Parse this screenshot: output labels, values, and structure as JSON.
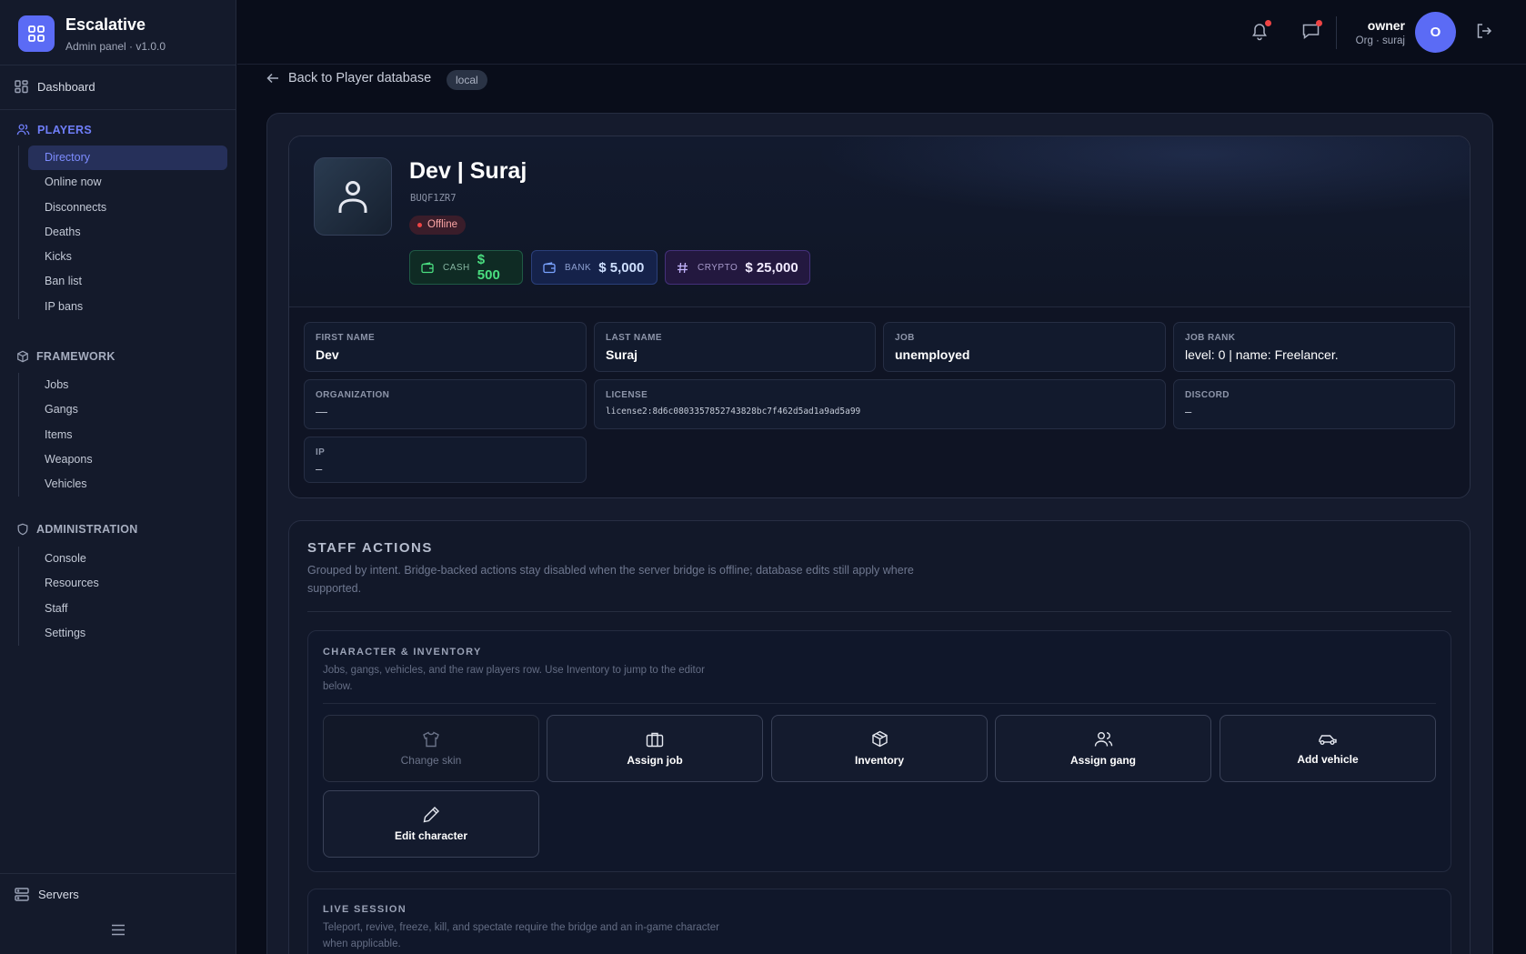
{
  "brand": {
    "name": "Escalative",
    "subtitle": "Admin panel · v1.0.0"
  },
  "sidebar": {
    "dashboard": "Dashboard",
    "sections": [
      {
        "title": "PLAYERS",
        "items": [
          "Directory",
          "Online now",
          "Disconnects",
          "Deaths",
          "Kicks",
          "Ban list",
          "IP bans"
        ]
      },
      {
        "title": "FRAMEWORK",
        "items": [
          "Jobs",
          "Gangs",
          "Items",
          "Weapons",
          "Vehicles"
        ]
      },
      {
        "title": "ADMINISTRATION",
        "items": [
          "Console",
          "Resources",
          "Staff",
          "Settings"
        ]
      }
    ],
    "active_item": "Directory",
    "servers": "Servers"
  },
  "topbar": {
    "user_name": "owner",
    "user_org": "Org · suraj",
    "avatar_letter": "O"
  },
  "back_link": "Back to Player database",
  "env_tag": "local",
  "player": {
    "name": "Dev | Suraj",
    "code": "BUQF1ZR7",
    "status": "Offline",
    "money": {
      "cash": {
        "label": "CASH",
        "value": "$ 500"
      },
      "bank": {
        "label": "BANK",
        "value": "$ 5,000"
      },
      "crypto": {
        "label": "CRYPTO",
        "value": "$ 25,000"
      }
    },
    "fields": {
      "first_name": {
        "label": "FIRST NAME",
        "value": "Dev"
      },
      "last_name": {
        "label": "LAST NAME",
        "value": "Suraj"
      },
      "job": {
        "label": "JOB",
        "value": "unemployed"
      },
      "job_rank": {
        "label": "JOB RANK",
        "value": "level: 0 | name: Freelancer."
      },
      "organization": {
        "label": "ORGANIZATION",
        "value": "—"
      },
      "license": {
        "label": "LICENSE",
        "value": "license2:8d6c0803357852743828bc7f462d5ad1a9ad5a99"
      },
      "discord": {
        "label": "DISCORD",
        "value": "–"
      },
      "ip": {
        "label": "IP",
        "value": "–"
      }
    }
  },
  "staff_actions": {
    "title": "STAFF ACTIONS",
    "description": "Grouped by intent. Bridge-backed actions stay disabled when the server bridge is offline; database edits still apply where supported.",
    "character_inventory": {
      "title": "CHARACTER & INVENTORY",
      "description": "Jobs, gangs, vehicles, and the raw players row. Use Inventory to jump to the editor below.",
      "buttons": {
        "change_skin": "Change skin",
        "assign_job": "Assign job",
        "inventory": "Inventory",
        "assign_gang": "Assign gang",
        "add_vehicle": "Add vehicle",
        "edit_character": "Edit character"
      }
    },
    "live_session": {
      "title": "LIVE SESSION",
      "description": "Teleport, revive, freeze, kill, and spectate require the bridge and an in-game character when applicable."
    }
  },
  "colors": {
    "accent": "#5b6bf5",
    "active_nav": "#7d8cff",
    "cash": "#4ade80",
    "offline": "#ef4444"
  }
}
